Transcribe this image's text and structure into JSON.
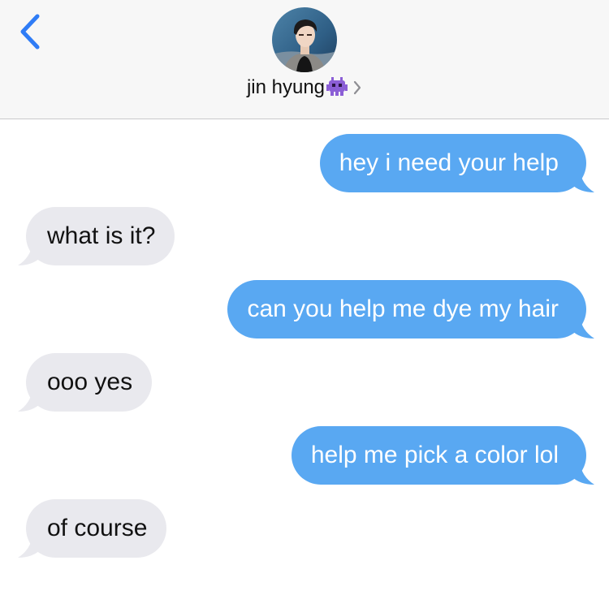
{
  "header": {
    "back_icon": "chevron-left-icon",
    "contact_name": "jin hyung",
    "contact_emoji": "👾",
    "disclosure_icon": "chevron-right-icon"
  },
  "colors": {
    "outgoing_bubble": "#59a8f2",
    "incoming_bubble": "#e9e9ee",
    "accent": "#2f7cf6",
    "header_bg": "#f7f7f7"
  },
  "messages": [
    {
      "direction": "outgoing",
      "text": "hey i need your help"
    },
    {
      "direction": "incoming",
      "text": "what is it?"
    },
    {
      "direction": "outgoing",
      "text": "can you help me dye my hair"
    },
    {
      "direction": "incoming",
      "text": "ooo yes"
    },
    {
      "direction": "outgoing",
      "text": "help me pick a color lol"
    },
    {
      "direction": "incoming",
      "text": "of course"
    }
  ]
}
